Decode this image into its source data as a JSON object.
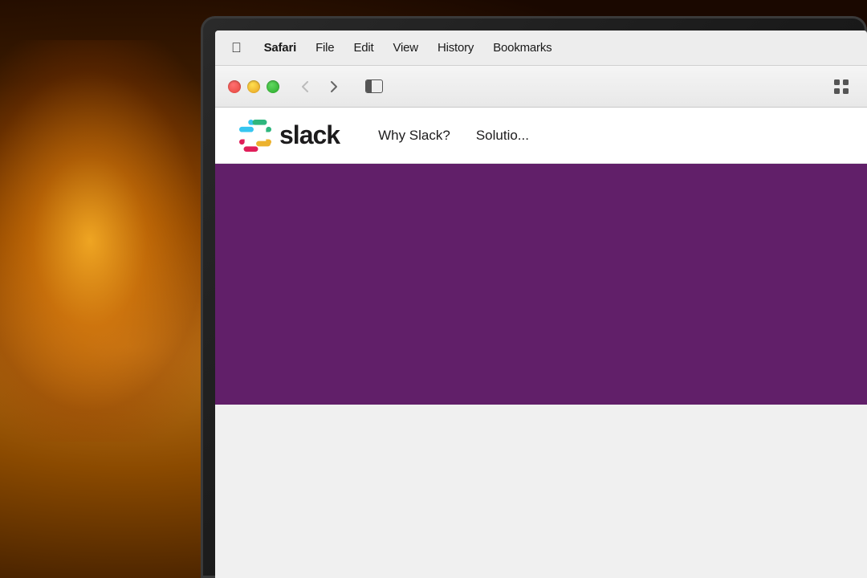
{
  "background": {
    "color": "#1a0800"
  },
  "menu_bar": {
    "items": [
      {
        "id": "apple",
        "label": "",
        "bold": false,
        "is_apple": true
      },
      {
        "id": "safari",
        "label": "Safari",
        "bold": true
      },
      {
        "id": "file",
        "label": "File",
        "bold": false
      },
      {
        "id": "edit",
        "label": "Edit",
        "bold": false
      },
      {
        "id": "view",
        "label": "View",
        "bold": false
      },
      {
        "id": "history",
        "label": "History",
        "bold": false
      },
      {
        "id": "bookmarks",
        "label": "Bookmarks",
        "bold": false
      }
    ]
  },
  "browser_toolbar": {
    "back_button_label": "‹",
    "forward_button_label": "›",
    "grid_icon": "⠿"
  },
  "traffic_lights": {
    "red_label": "close",
    "yellow_label": "minimize",
    "green_label": "maximize"
  },
  "slack_nav": {
    "wordmark": "slack",
    "items": [
      {
        "id": "why-slack",
        "label": "Why Slack?"
      },
      {
        "id": "solutions",
        "label": "Solutio..."
      }
    ]
  }
}
